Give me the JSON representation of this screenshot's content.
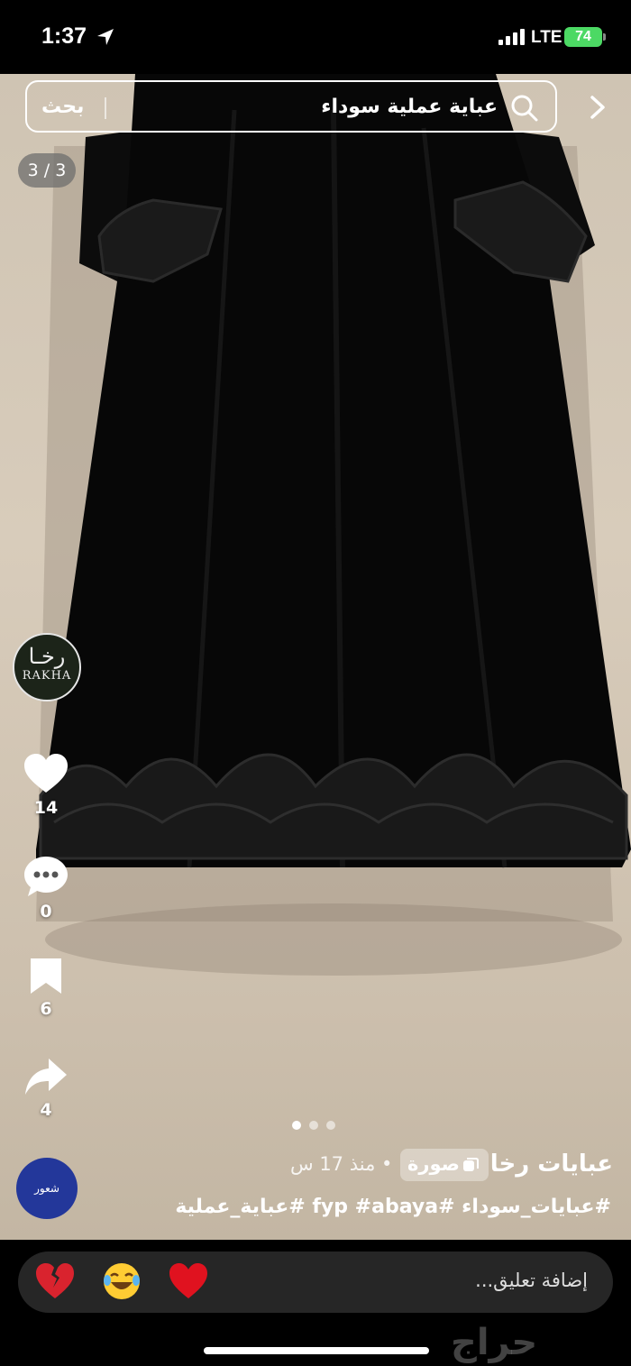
{
  "status_bar": {
    "time": "1:37",
    "network": "LTE",
    "battery": "74"
  },
  "search": {
    "query": "عباية عملية سوداء",
    "button_label": "بحث"
  },
  "image_counter": "3 / 3",
  "brand_avatar": {
    "text_ar": "رخـا",
    "text_en": "RAKHA"
  },
  "actions": {
    "likes": "14",
    "comments": "0",
    "saves": "6",
    "shares": "4"
  },
  "carousel": {
    "dots": 3,
    "active": 0
  },
  "post": {
    "author": "عبايات رخا",
    "type_label": "صورة",
    "time_ago": "• منذ 17 س",
    "hashtags": "#عبايات_سوداء #fyp #abaya #عباية_عملية",
    "user_avatar_text": "شعور"
  },
  "comment_bar": {
    "placeholder": "إضافة تعليق...",
    "emojis": [
      "broken-heart",
      "laughing-face",
      "red-heart"
    ]
  },
  "watermark": "حراج",
  "colors": {
    "like": "#ffffff",
    "battery": "#4cd964",
    "user_avatar": "#23379a"
  }
}
